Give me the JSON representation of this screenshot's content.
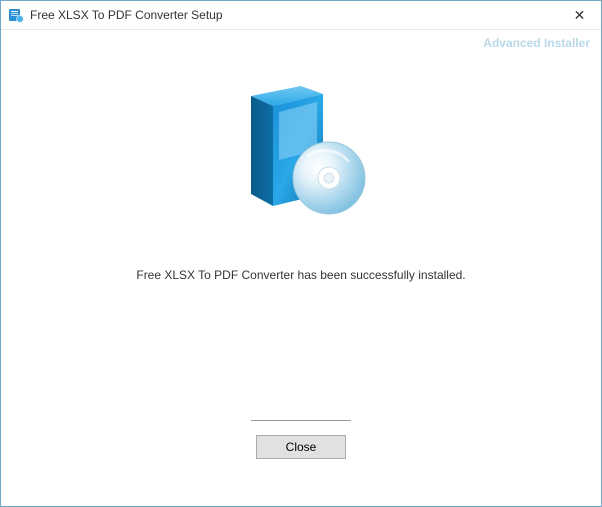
{
  "titlebar": {
    "title": "Free XLSX To PDF Converter Setup",
    "close_symbol": "✕"
  },
  "brand": {
    "label": "Advanced Installer"
  },
  "main": {
    "status_message": "Free XLSX To PDF Converter has been successfully installed.",
    "close_button_label": "Close"
  }
}
